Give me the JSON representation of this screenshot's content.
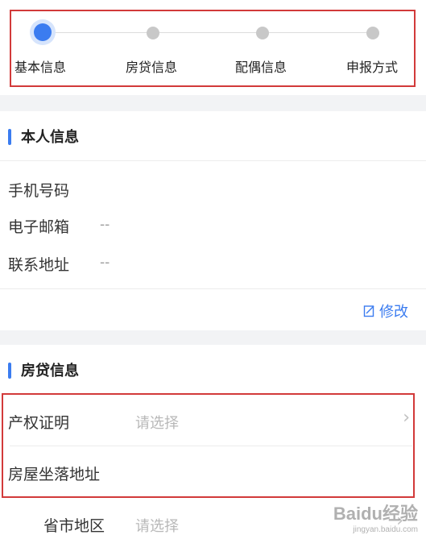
{
  "stepper": {
    "steps": [
      {
        "label": "基本信息",
        "active": true
      },
      {
        "label": "房贷信息",
        "active": false
      },
      {
        "label": "配偶信息",
        "active": false
      },
      {
        "label": "申报方式",
        "active": false
      }
    ],
    "active_color": "#3b7cf0",
    "inactive_color": "#c8c8c8"
  },
  "personal": {
    "title": "本人信息",
    "rows": [
      {
        "label": "手机号码",
        "value": ""
      },
      {
        "label": "电子邮箱",
        "value": "--"
      },
      {
        "label": "联系地址",
        "value": "--"
      }
    ],
    "edit_label": "修改"
  },
  "mortgage": {
    "title": "房贷信息",
    "property_cert": {
      "label": "产权证明",
      "placeholder": "请选择"
    },
    "house_address": {
      "label": "房屋坐落地址"
    },
    "region": {
      "label": "省市地区",
      "placeholder": "请选择"
    }
  },
  "watermark": {
    "main": "Baidu经验",
    "sub": "jingyan.baidu.com"
  },
  "highlight_color": "#d23a3a"
}
